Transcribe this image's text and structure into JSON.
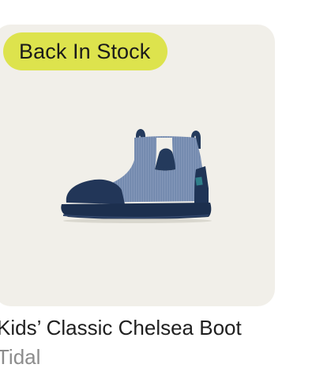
{
  "badge": {
    "label": "Back In Stock",
    "color": "#dde34d"
  },
  "product": {
    "name": "Kids’ Classic Chelsea Boot",
    "color_name": "Tidal",
    "image_icon": "chelsea-boot-image",
    "tile_background": "#f1efe9"
  }
}
